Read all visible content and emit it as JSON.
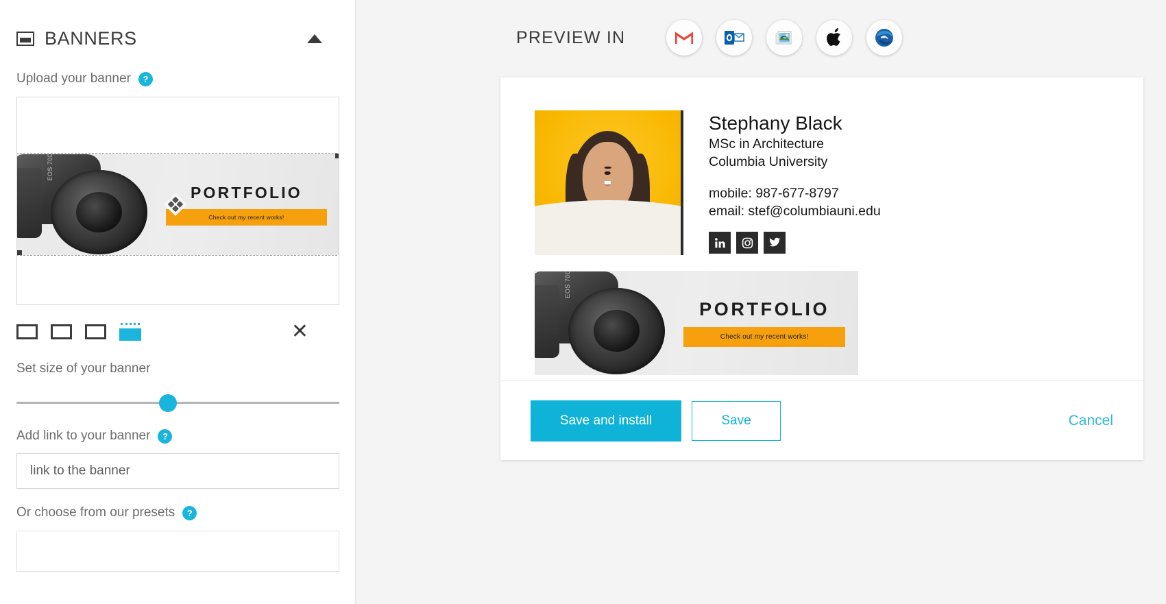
{
  "sidebar": {
    "panel_title": "BANNERS",
    "panel_icon": "banner-icon",
    "collapse_icon": "caret-up-icon",
    "upload": {
      "label": "Upload your banner",
      "help": "?",
      "close_icon": "close-icon",
      "ratios": [
        {
          "name": "ratio-small",
          "label": ""
        },
        {
          "name": "ratio-medium",
          "label": ""
        },
        {
          "name": "ratio-large",
          "label": ""
        },
        {
          "name": "ratio-custom-active",
          "label": ""
        }
      ]
    },
    "size": {
      "label": "Set size of your banner",
      "value_percent": 47
    },
    "link": {
      "label": "Add link to your banner",
      "help": "?",
      "placeholder": "link to the banner",
      "value": ""
    },
    "presets": {
      "label": "Or choose from our presets",
      "help": "?"
    }
  },
  "preview": {
    "label": "PREVIEW IN",
    "clients": [
      {
        "name": "gmail-icon",
        "title": "Gmail"
      },
      {
        "name": "outlook-icon",
        "title": "Outlook"
      },
      {
        "name": "windows-mail-icon",
        "title": "Mail"
      },
      {
        "name": "apple-mail-icon",
        "title": "Apple Mail"
      },
      {
        "name": "thunderbird-icon",
        "title": "Thunderbird"
      }
    ]
  },
  "signature": {
    "photo_alt": "portrait-photo",
    "name": "Stephany Black",
    "title": "MSc in Architecture",
    "organization": "Columbia University",
    "mobile": "mobile: 987-677-8797",
    "email": "email: stef@columbiauni.edu",
    "socials": [
      {
        "name": "linkedin-icon"
      },
      {
        "name": "instagram-icon"
      },
      {
        "name": "twitter-icon"
      }
    ],
    "banner": {
      "headline": "PORTFOLIO",
      "cta": "Check out my recent works!",
      "camera_label": "EOS 70D"
    }
  },
  "actions": {
    "save_install": "Save and install",
    "save": "Save",
    "cancel": "Cancel"
  },
  "colors": {
    "accent": "#0fb3d8",
    "help_dot": "#19b5dd",
    "banner_cta": "#f5a00c",
    "photo_bg": "#f9b700",
    "social_chip": "#2b2b2b",
    "page_bg": "#f4f4f4"
  }
}
